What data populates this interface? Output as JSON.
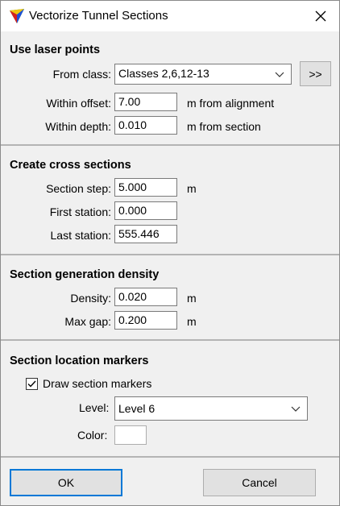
{
  "window": {
    "title": "Vectorize Tunnel Sections",
    "close_glyph": "✕"
  },
  "laser": {
    "title": "Use laser points",
    "from_class_label": "From class:",
    "from_class_value": "Classes 2,6,12-13",
    "more_button": ">>",
    "within_offset_label": "Within offset:",
    "within_offset_value": "7.00",
    "within_offset_unit": "m from alignment",
    "within_depth_label": "Within depth:",
    "within_depth_value": "0.010",
    "within_depth_unit": "m from section"
  },
  "cross": {
    "title": "Create cross sections",
    "step_label": "Section step:",
    "step_value": "5.000",
    "step_unit": "m",
    "first_label": "First station:",
    "first_value": "0.000",
    "last_label": "Last station:",
    "last_value": "555.446"
  },
  "density": {
    "title": "Section generation density",
    "density_label": "Density:",
    "density_value": "0.020",
    "density_unit": "m",
    "maxgap_label": "Max gap:",
    "maxgap_value": "0.200",
    "maxgap_unit": "m"
  },
  "markers": {
    "title": "Section location markers",
    "draw_label": "Draw section markers",
    "draw_checked": true,
    "level_label": "Level:",
    "level_value": "Level 6",
    "color_label": "Color:",
    "color_value": "#ffffff"
  },
  "footer": {
    "ok_label": "OK",
    "cancel_label": "Cancel"
  },
  "colors": {
    "accent": "#0078d7",
    "dialog_bg": "#f0f0f0"
  }
}
